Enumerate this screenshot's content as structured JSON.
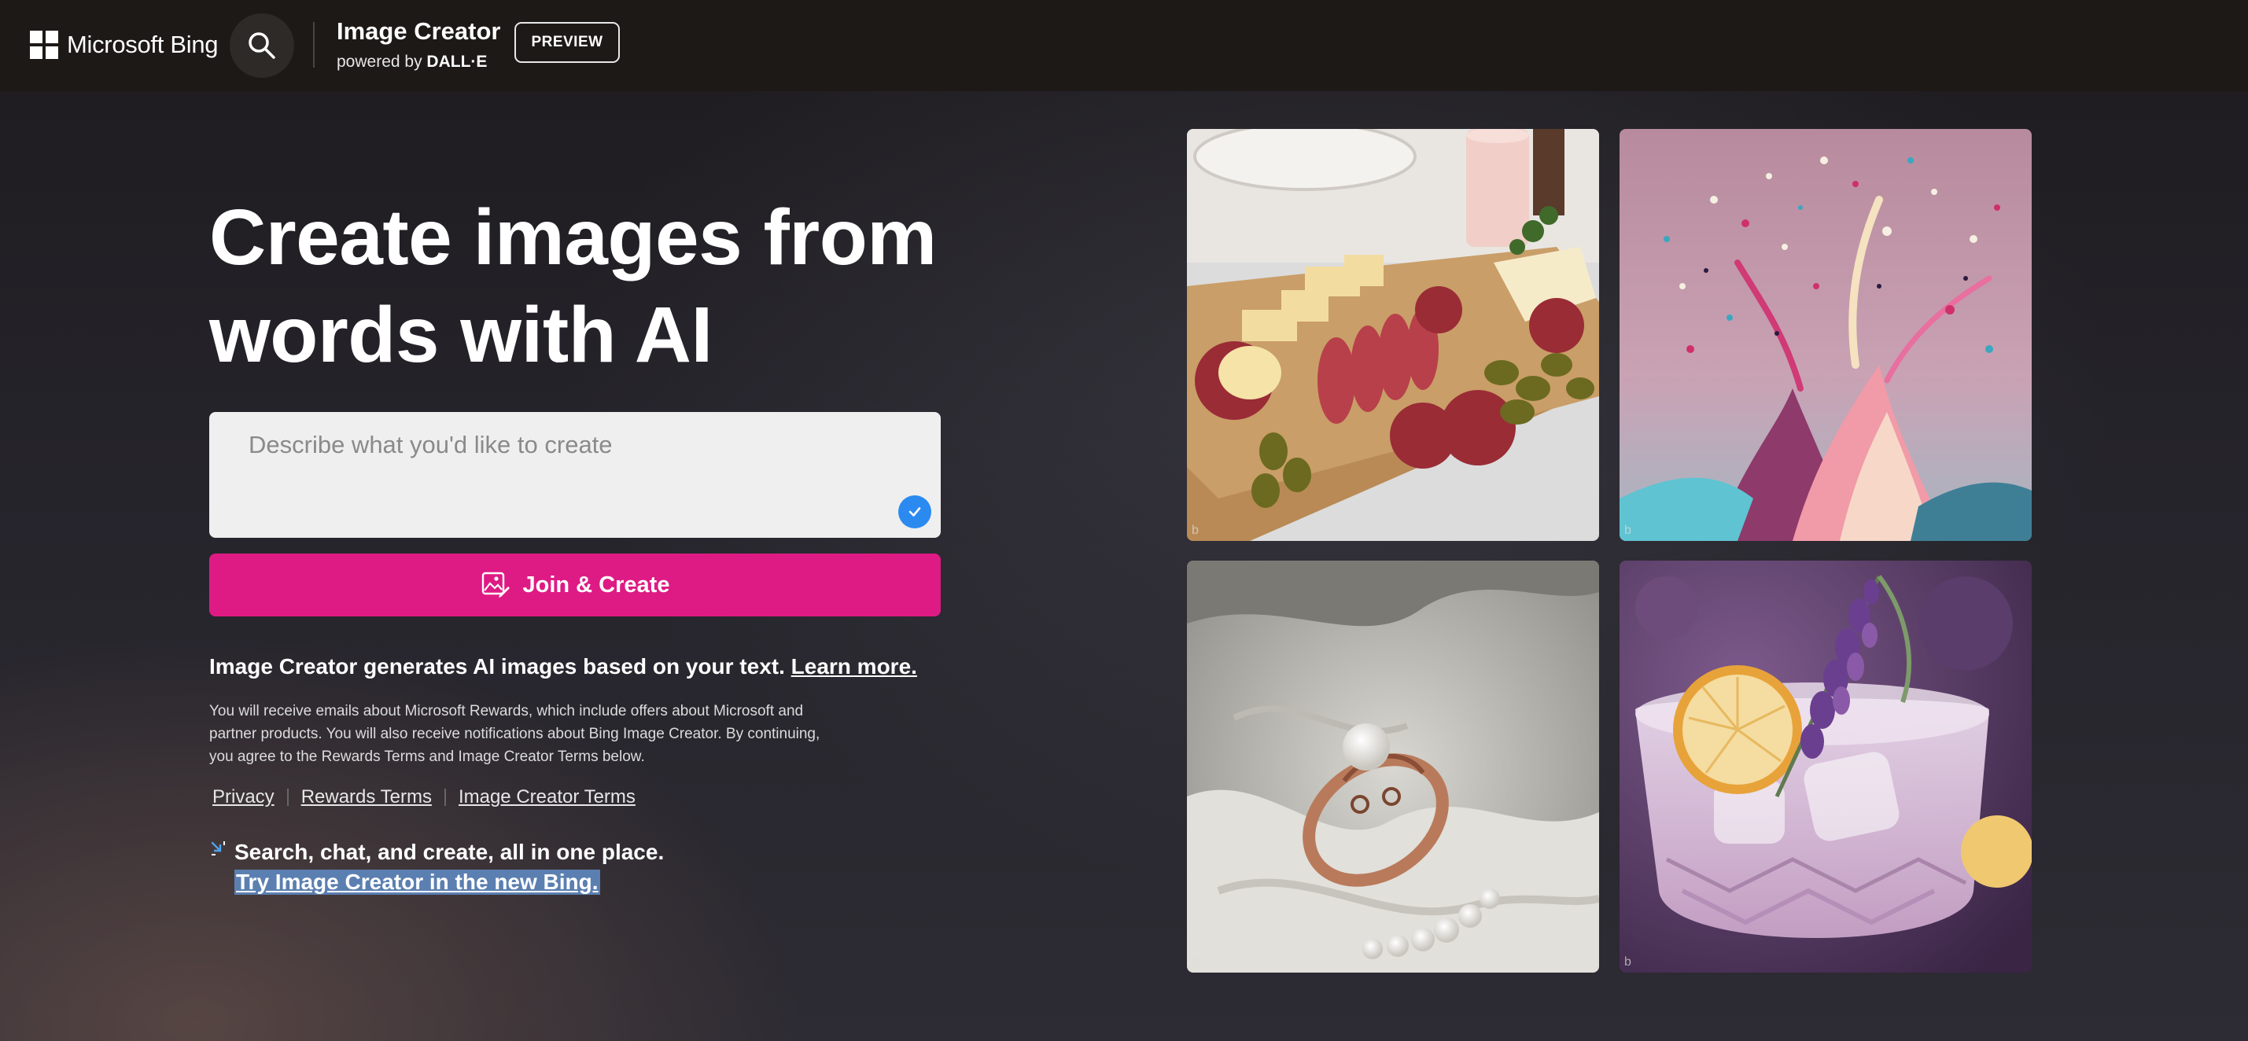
{
  "header": {
    "brand": "Microsoft Bing",
    "product_title": "Image Creator",
    "powered_by_prefix": "powered by",
    "powered_by_name": "DALL·E",
    "badge": "PREVIEW"
  },
  "hero": {
    "line1": "Create images from",
    "line2": "words with AI"
  },
  "prompt": {
    "placeholder": "Describe what you'd like to create",
    "value": ""
  },
  "join_button": {
    "label": "Join & Create"
  },
  "description": {
    "text": "Image Creator generates AI images based on your text.",
    "link": "Learn more."
  },
  "fine_print": "You will receive emails about Microsoft Rewards, which include offers about Microsoft and partner products. You will also receive notifications about Bing Image Creator. By continuing, you agree to the Rewards Terms and Image Creator Terms below.",
  "legal_links": {
    "privacy": "Privacy",
    "rewards_terms": "Rewards Terms",
    "image_creator_terms": "Image Creator Terms"
  },
  "promo": {
    "text": "Search, chat, and create, all in one place.",
    "link": "Try Image Creator in the new Bing."
  },
  "gallery": [
    {
      "subject": "charcuterie-board"
    },
    {
      "subject": "paint-splash"
    },
    {
      "subject": "pearl-ring"
    },
    {
      "subject": "lavender-cocktail"
    }
  ],
  "colors": {
    "accent": "#de1b84",
    "check": "#2b8af0",
    "topbar": "#1c1917",
    "link_highlight": "#5b7fb1"
  }
}
